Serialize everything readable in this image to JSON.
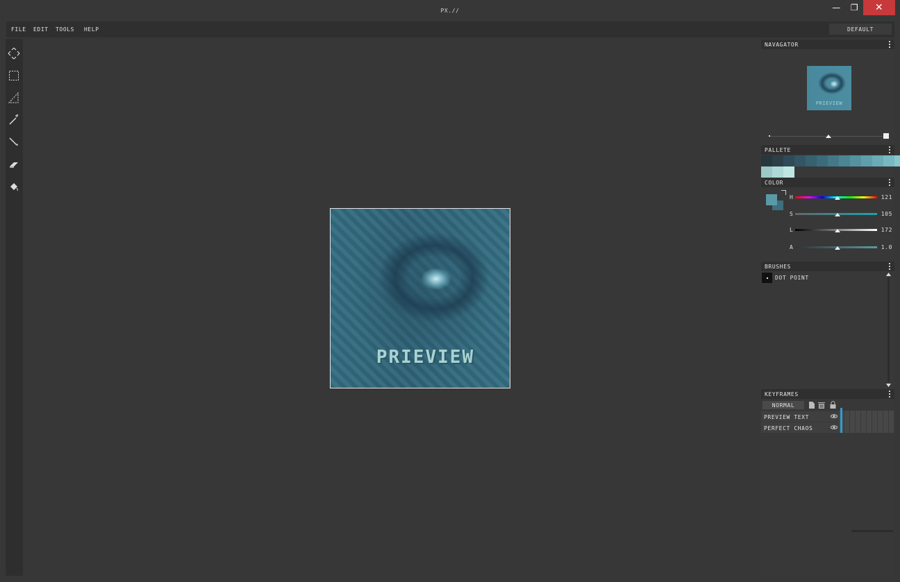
{
  "window": {
    "title": "PX.//",
    "controls": {
      "minimize": "—",
      "maximize": "❐",
      "close": "✕"
    }
  },
  "menu": {
    "items": [
      "FILE",
      "EDIT",
      "TOOLS",
      "HELP"
    ],
    "workspace": "DEFAULT"
  },
  "tools": [
    "move-icon",
    "marquee-select-icon",
    "lasso-icon",
    "magic-wand-icon",
    "pencil-icon",
    "eraser-icon",
    "fill-bucket-icon"
  ],
  "canvas": {
    "overlay_text": "PRIEVIEW"
  },
  "panels": {
    "navigator": {
      "title": "NAVAGATOR",
      "thumb_text": "PRIEVIEW",
      "zoom_fraction": 0.5
    },
    "palette": {
      "title": "PALLETE",
      "row1": [
        "#27383d",
        "#2c4048",
        "#304b56",
        "#345564",
        "#386070",
        "#3c6b7b",
        "#447887",
        "#4c8593",
        "#55929f",
        "#5f9fab",
        "#6baab6",
        "#79b8c1",
        "#88c6cd",
        "#97d4d9",
        "#a8e2e6"
      ],
      "row2": [
        "#9cc9c7",
        "#aed8d6",
        "#bfe6e3"
      ]
    },
    "color": {
      "title": "COLOR",
      "primary": "#5a9aa6",
      "secondary": "#3e6f7e",
      "sliders": [
        {
          "label": "H",
          "value": "121",
          "fraction": 0.52
        },
        {
          "label": "S",
          "value": "105",
          "fraction": 0.52
        },
        {
          "label": "L",
          "value": "172",
          "fraction": 0.52
        },
        {
          "label": "A",
          "value": "1.0",
          "fraction": 0.52
        }
      ]
    },
    "brushes": {
      "title": "BRUSHES",
      "items": [
        "DOT POINT"
      ]
    },
    "keyframes": {
      "title": "KEYFRAMES",
      "blend_mode": "NORMAL",
      "layers": [
        "PREVIEW TEXT",
        "PERFECT CHAOS"
      ]
    }
  }
}
